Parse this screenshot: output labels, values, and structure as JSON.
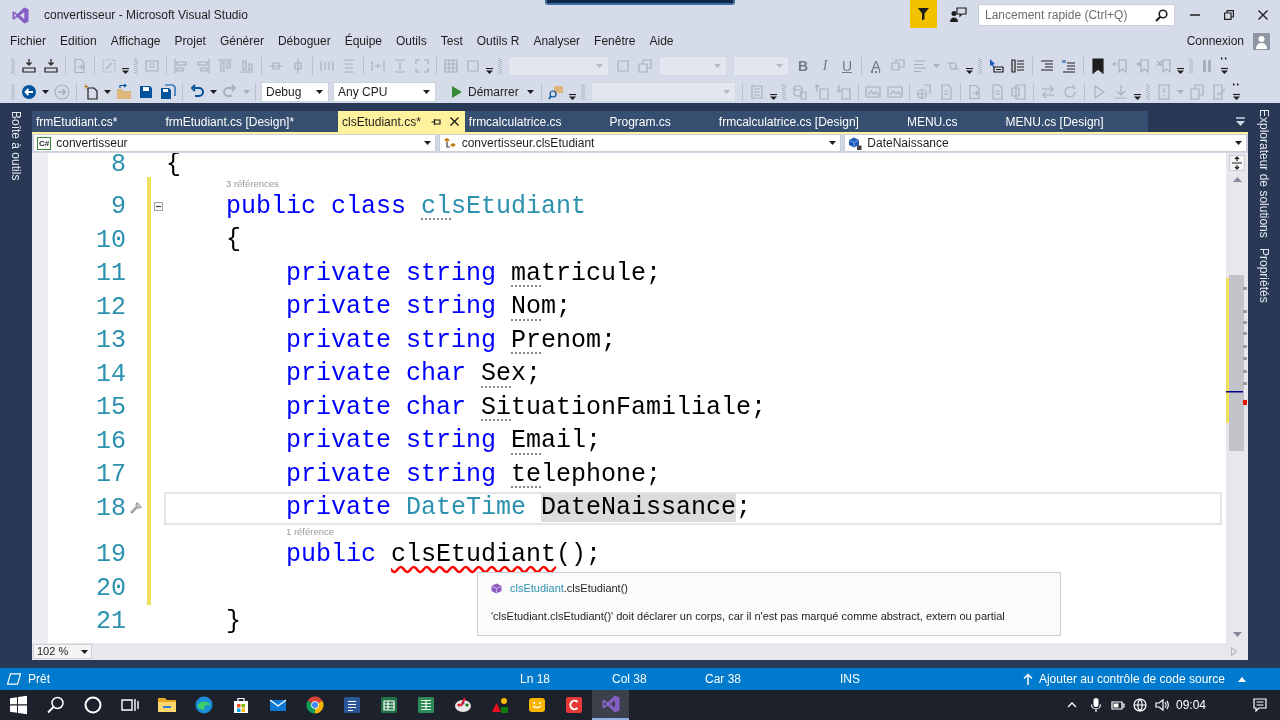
{
  "window": {
    "title": "convertisseur - Microsoft Visual Studio",
    "quick_launch": {
      "placeholder": "Lancement rapide (Ctrl+Q)"
    }
  },
  "menu": [
    "Fichier",
    "Edition",
    "Affichage",
    "Projet",
    "Générer",
    "Déboguer",
    "Équipe",
    "Outils",
    "Test",
    "Outils R",
    "Analyser",
    "Fenêtre",
    "Aide"
  ],
  "account": "Connexion",
  "toolbars": [
    [
      {
        "kind": "grip"
      },
      {
        "kind": "build",
        "disabled": false
      },
      {
        "kind": "build",
        "disabled": false
      },
      {
        "kind": "separator"
      },
      {
        "kind": "doc-arrow",
        "disabled": true
      },
      {
        "kind": "separator"
      },
      {
        "kind": "dot-grid",
        "disabled": true
      },
      {
        "kind": "overflow"
      },
      {
        "kind": "grip"
      },
      {
        "kind": "tab-order",
        "disabled": true
      },
      {
        "kind": "separator"
      },
      {
        "kind": "align-left",
        "disabled": true
      },
      {
        "kind": "align-right",
        "disabled": true
      },
      {
        "kind": "align-top",
        "disabled": true
      },
      {
        "kind": "align-bottom",
        "disabled": true
      },
      {
        "kind": "separator"
      },
      {
        "kind": "center-h",
        "disabled": true
      },
      {
        "kind": "center-v",
        "disabled": true
      },
      {
        "kind": "separator"
      },
      {
        "kind": "space-h",
        "disabled": true
      },
      {
        "kind": "space-v",
        "disabled": true
      },
      {
        "kind": "separator"
      },
      {
        "kind": "size-width",
        "disabled": true
      },
      {
        "kind": "size-height",
        "disabled": true
      },
      {
        "kind": "size-both",
        "disabled": true
      },
      {
        "kind": "separator"
      },
      {
        "kind": "grid",
        "disabled": true
      },
      {
        "kind": "bounds",
        "disabled": true
      },
      {
        "kind": "overflow"
      },
      {
        "kind": "grip"
      },
      {
        "kind": "combo-l",
        "disabled": true
      },
      {
        "kind": "bring-front",
        "disabled": true
      },
      {
        "kind": "send-back",
        "disabled": true
      },
      {
        "kind": "combo-m",
        "disabled": true
      },
      {
        "kind": "combo-s",
        "disabled": true
      },
      {
        "kind": "bold",
        "label": "B",
        "disabled": true
      },
      {
        "kind": "italic",
        "label": "I",
        "disabled": true
      },
      {
        "kind": "underline",
        "label": "U",
        "disabled": true
      },
      {
        "kind": "separator"
      },
      {
        "kind": "font-color",
        "label": "A",
        "disabled": true
      },
      {
        "kind": "highlight",
        "disabled": true
      },
      {
        "kind": "text-align",
        "disabled": true
      },
      {
        "kind": "caret",
        "disabled": true
      },
      {
        "kind": "wrap",
        "disabled": true
      },
      {
        "kind": "overflow"
      },
      {
        "kind": "grip"
      },
      {
        "kind": "pointer-box",
        "disabled": false
      },
      {
        "kind": "list",
        "disabled": false
      },
      {
        "kind": "separator"
      },
      {
        "kind": "indent",
        "disabled": false
      },
      {
        "kind": "comment",
        "disabled": false
      },
      {
        "kind": "separator"
      },
      {
        "kind": "bookmark",
        "disabled": false
      },
      {
        "kind": "bookmark-prev",
        "disabled": true
      },
      {
        "kind": "bookmark-next",
        "disabled": true
      },
      {
        "kind": "bookmark-clear",
        "disabled": true
      },
      {
        "kind": "overflow"
      },
      {
        "kind": "grip"
      },
      {
        "kind": "pause",
        "disabled": true
      },
      {
        "kind": "more"
      }
    ],
    [
      {
        "kind": "grip"
      },
      {
        "kind": "nav-back",
        "disabled": false
      },
      {
        "kind": "caret",
        "disabled": false
      },
      {
        "kind": "nav-forward",
        "disabled": true
      },
      {
        "kind": "separator"
      },
      {
        "kind": "new-item",
        "disabled": false
      },
      {
        "kind": "caret",
        "disabled": false
      },
      {
        "kind": "open",
        "disabled": false
      },
      {
        "kind": "save",
        "disabled": false
      },
      {
        "kind": "save-all",
        "disabled": false
      },
      {
        "kind": "separator"
      },
      {
        "kind": "undo",
        "disabled": false
      },
      {
        "kind": "caret",
        "disabled": false
      },
      {
        "kind": "redo",
        "disabled": true
      },
      {
        "kind": "caret",
        "disabled": true
      },
      {
        "kind": "separator"
      },
      {
        "kind": "select-m",
        "value": "Debug"
      },
      {
        "kind": "select-l",
        "value": "Any CPU"
      },
      {
        "kind": "run",
        "label": "Démarrer"
      },
      {
        "kind": "separator"
      },
      {
        "kind": "find",
        "disabled": false
      },
      {
        "kind": "overflow"
      },
      {
        "kind": "grip"
      },
      {
        "kind": "combo-xl",
        "disabled": true
      },
      {
        "kind": "separator"
      },
      {
        "kind": "doc-list",
        "disabled": true
      },
      {
        "kind": "overflow"
      },
      {
        "kind": "grip"
      },
      {
        "kind": "db-doc",
        "disabled": true
      },
      {
        "kind": "doc-up",
        "disabled": true
      },
      {
        "kind": "doc-down",
        "disabled": true
      },
      {
        "kind": "separator"
      },
      {
        "kind": "image",
        "disabled": true
      },
      {
        "kind": "image",
        "disabled": true
      },
      {
        "kind": "separator"
      },
      {
        "kind": "globe-doc",
        "disabled": true
      },
      {
        "kind": "doc",
        "disabled": true
      },
      {
        "kind": "separator"
      },
      {
        "kind": "doc-arrow",
        "disabled": true
      },
      {
        "kind": "doc",
        "disabled": true
      },
      {
        "kind": "word-doc",
        "disabled": true
      },
      {
        "kind": "separator"
      },
      {
        "kind": "swap",
        "disabled": true
      },
      {
        "kind": "refresh",
        "disabled": true
      },
      {
        "kind": "separator"
      },
      {
        "kind": "play",
        "disabled": true
      },
      {
        "kind": "download",
        "disabled": true
      },
      {
        "kind": "overflow"
      },
      {
        "kind": "grip"
      },
      {
        "kind": "alert-doc",
        "disabled": true
      },
      {
        "kind": "caret",
        "disabled": true
      },
      {
        "kind": "copy-doc",
        "disabled": true
      },
      {
        "kind": "check-doc",
        "disabled": true
      },
      {
        "kind": "more"
      }
    ]
  ],
  "side_panels": {
    "left": [
      "Boîte à outils"
    ],
    "right": [
      "Explorateur de solutions",
      "Propriétés"
    ]
  },
  "tabs": [
    {
      "label": "frmEtudiant.cs*",
      "selected": false
    },
    {
      "label": "frmEtudiant.cs [Design]*",
      "selected": false
    },
    {
      "label": "clsEtudiant.cs*",
      "selected": true
    },
    {
      "label": "frmcalculatrice.cs",
      "selected": false
    },
    {
      "label": "Program.cs",
      "selected": false
    },
    {
      "label": "frmcalculatrice.cs [Design]",
      "selected": false
    },
    {
      "label": "MENU.cs",
      "selected": false
    },
    {
      "label": "MENU.cs [Design]",
      "selected": false
    }
  ],
  "navigation": [
    {
      "kind": "project",
      "badge": "C#",
      "value": "convertisseur"
    },
    {
      "kind": "class",
      "value": "convertisseur.clsEtudiant"
    },
    {
      "kind": "member",
      "value": "DateNaissance"
    }
  ],
  "editor": {
    "lines": [
      {
        "number": "8",
        "changed": false,
        "current": false,
        "tokens": [
          {
            "text": "{",
            "kind": "plain"
          }
        ]
      },
      {
        "number": "9",
        "codelens": "3 références",
        "expanded": true,
        "changed": true,
        "current": false,
        "tokens": [
          {
            "text": "    public class ",
            "kind": "keyword"
          },
          {
            "text": "cl",
            "kind": "type",
            "hint": true
          },
          {
            "text": "sEtudiant",
            "kind": "type"
          }
        ]
      },
      {
        "number": "10",
        "changed": true,
        "current": false,
        "tokens": [
          {
            "text": "    {",
            "kind": "plain"
          }
        ]
      },
      {
        "number": "11",
        "changed": true,
        "current": false,
        "tokens": [
          {
            "text": "        private string ",
            "kind": "keyword"
          },
          {
            "text": "ma",
            "kind": "plain",
            "hint": true
          },
          {
            "text": "tricule;",
            "kind": "plain"
          }
        ]
      },
      {
        "number": "12",
        "changed": true,
        "current": false,
        "tokens": [
          {
            "text": "        private string ",
            "kind": "keyword"
          },
          {
            "text": "No",
            "kind": "plain",
            "hint": true
          },
          {
            "text": "m;",
            "kind": "plain"
          }
        ]
      },
      {
        "number": "13",
        "changed": true,
        "current": false,
        "tokens": [
          {
            "text": "        private string ",
            "kind": "keyword"
          },
          {
            "text": "Pr",
            "kind": "plain",
            "hint": true
          },
          {
            "text": "enom;",
            "kind": "plain"
          }
        ]
      },
      {
        "number": "14",
        "changed": true,
        "current": false,
        "tokens": [
          {
            "text": "        private char ",
            "kind": "keyword"
          },
          {
            "text": "Se",
            "kind": "plain",
            "hint": true
          },
          {
            "text": "x;",
            "kind": "plain"
          }
        ]
      },
      {
        "number": "15",
        "changed": true,
        "current": false,
        "tokens": [
          {
            "text": "        private char ",
            "kind": "keyword"
          },
          {
            "text": "Si",
            "kind": "plain",
            "hint": true
          },
          {
            "text": "tuationFamiliale;",
            "kind": "plain"
          }
        ]
      },
      {
        "number": "16",
        "changed": true,
        "current": false,
        "tokens": [
          {
            "text": "        private string ",
            "kind": "keyword"
          },
          {
            "text": "Em",
            "kind": "plain",
            "hint": true
          },
          {
            "text": "ail;",
            "kind": "plain"
          }
        ]
      },
      {
        "number": "17",
        "changed": true,
        "current": false,
        "tokens": [
          {
            "text": "        private string ",
            "kind": "keyword"
          },
          {
            "text": "te",
            "kind": "plain",
            "hint": true
          },
          {
            "text": "lephone;",
            "kind": "plain"
          }
        ]
      },
      {
        "number": "18",
        "changed": true,
        "current": true,
        "quick_action": true,
        "tokens": [
          {
            "text": "        private ",
            "kind": "keyword"
          },
          {
            "text": "DateTime ",
            "kind": "type"
          },
          {
            "text": "DateNaissance",
            "kind": "plain",
            "highlight": true
          },
          {
            "text": ";",
            "kind": "plain"
          }
        ]
      },
      {
        "number": "19",
        "codelens": "1 référence",
        "changed": true,
        "current": false,
        "tokens": [
          {
            "text": "        public ",
            "kind": "keyword"
          },
          {
            "text": "clsEtudiant",
            "kind": "plain",
            "error": true
          },
          {
            "text": "();",
            "kind": "plain"
          }
        ]
      },
      {
        "number": "20",
        "changed": true,
        "current": false
      },
      {
        "number": "21",
        "changed": false,
        "current": false,
        "tokens": [
          {
            "text": "    }",
            "kind": "plain"
          }
        ]
      }
    ],
    "error_tip": {
      "signature": [
        {
          "text": "clsEtudiant",
          "kind": "type"
        },
        {
          "text": ".clsEtudiant()",
          "kind": "plain"
        }
      ],
      "message": "'clsEtudiant.clsEtudiant()' doit déclarer un corps, car il n'est pas marqué comme abstract, extern ou partial"
    },
    "zoom": "102 %"
  },
  "status_bar": {
    "message": "Prêt",
    "line": "Ln 18",
    "column": "Col 38",
    "character": "Car 38",
    "mode": "INS",
    "source_control": "Ajouter au contrôle de code source"
  },
  "taskbar": {
    "buttons": [
      {
        "kind": "start"
      },
      {
        "kind": "search"
      },
      {
        "kind": "assistant"
      },
      {
        "kind": "task-view"
      }
    ],
    "apps": [
      {
        "kind": "files",
        "selected": false
      },
      {
        "kind": "browser-wave",
        "selected": false
      },
      {
        "kind": "store",
        "selected": false
      },
      {
        "kind": "mail",
        "selected": false
      },
      {
        "kind": "browser-ring",
        "selected": false
      },
      {
        "kind": "word-processor",
        "selected": false
      },
      {
        "kind": "spreadsheet",
        "selected": false
      },
      {
        "kind": "spreadsheet-alt",
        "selected": false
      },
      {
        "kind": "paint",
        "selected": false
      },
      {
        "kind": "shapes",
        "selected": false
      },
      {
        "kind": "chat",
        "selected": false
      },
      {
        "kind": "c-tile",
        "selected": false
      },
      {
        "kind": "ide",
        "selected": true
      }
    ],
    "clock": "09:04"
  }
}
